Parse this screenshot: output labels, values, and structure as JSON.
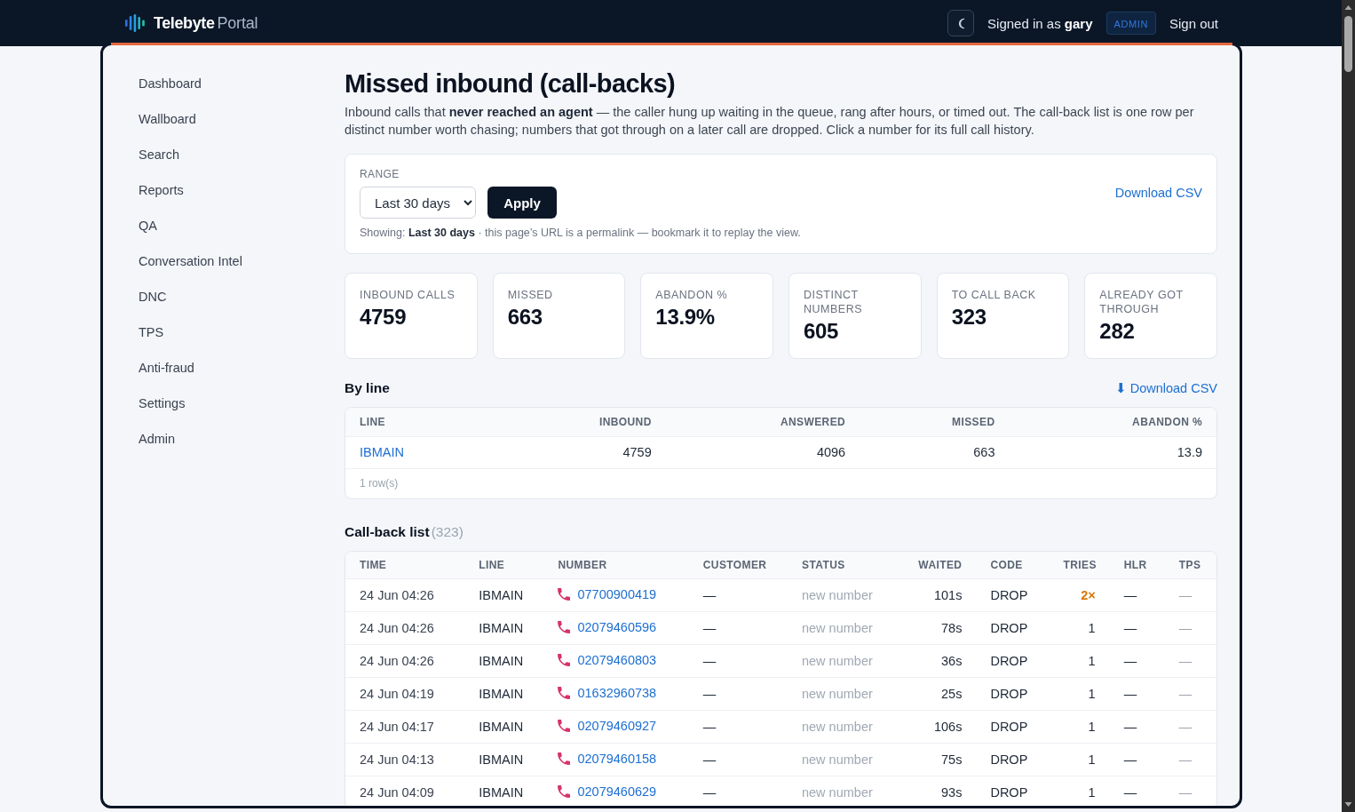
{
  "header": {
    "brand": "Telebyte",
    "brand_suffix": "Portal",
    "signed_in": "Signed in as **gary**",
    "role_badge": "ADMIN",
    "sign_out": "Sign out"
  },
  "sidebar": {
    "items": [
      {
        "label": "Dashboard",
        "selected": false
      },
      {
        "label": "Wallboard",
        "selected": false
      },
      {
        "label": "Search",
        "selected": false
      },
      {
        "label": "Reports",
        "selected": false
      },
      {
        "label": "QA",
        "selected": false
      },
      {
        "label": "Conversation Intel",
        "selected": false
      },
      {
        "label": "DNC",
        "selected": false
      },
      {
        "label": "TPS",
        "selected": false
      },
      {
        "label": "Anti-fraud",
        "selected": false
      },
      {
        "label": "Settings",
        "selected": false
      },
      {
        "label": "Admin",
        "selected": false
      }
    ]
  },
  "page": {
    "title": "Missed inbound (call-backs)",
    "description": "Inbound calls that **never reached an agent** — the caller hung up waiting in the queue, rang after hours, or timed out. The call-back list is one row per distinct number worth chasing; numbers that got through on a later call are dropped. Click a number for its full call history."
  },
  "range": {
    "label": "RANGE",
    "value": "Last 30 days",
    "apply": "Apply",
    "download": "Download CSV",
    "showing": "Showing: **Last 30 days** · this page’s URL is a permalink — bookmark it to replay the view."
  },
  "stats": [
    {
      "label": "INBOUND CALLS",
      "value": "4759"
    },
    {
      "label": "MISSED",
      "value": "663"
    },
    {
      "label": "ABANDON %",
      "value": "13.9%"
    },
    {
      "label": "DISTINCT NUMBERS",
      "value": "605"
    },
    {
      "label": "TO CALL BACK",
      "value": "323"
    },
    {
      "label": "ALREADY GOT THROUGH",
      "value": "282"
    }
  ],
  "by_line": {
    "title": "By line",
    "download": "⬇ Download CSV",
    "columns": [
      "LINE",
      "INBOUND",
      "ANSWERED",
      "MISSED",
      "ABANDON %"
    ],
    "rows": [
      {
        "line": "IBMAIN",
        "inbound": "4759",
        "answered": "4096",
        "missed": "663",
        "abandon": "13.9"
      }
    ],
    "footer": "1 row(s)"
  },
  "callbacks": {
    "title": "Call-back list",
    "count": "(323)",
    "columns": [
      "TIME",
      "LINE",
      "NUMBER",
      "CUSTOMER",
      "STATUS",
      "WAITED",
      "CODE",
      "TRIES",
      "HLR",
      "TPS"
    ],
    "rows": [
      {
        "time": "24 Jun 04:26",
        "line": "IBMAIN",
        "number": "07700900419",
        "customer": "—",
        "status": "new number",
        "waited": "101s",
        "code": "DROP",
        "tries": "2×",
        "repeat": true,
        "hlr": "—",
        "tps": "—"
      },
      {
        "time": "24 Jun 04:26",
        "line": "IBMAIN",
        "number": "02079460596",
        "customer": "—",
        "status": "new number",
        "waited": "78s",
        "code": "DROP",
        "tries": "1",
        "repeat": false,
        "hlr": "—",
        "tps": "—"
      },
      {
        "time": "24 Jun 04:26",
        "line": "IBMAIN",
        "number": "02079460803",
        "customer": "—",
        "status": "new number",
        "waited": "36s",
        "code": "DROP",
        "tries": "1",
        "repeat": false,
        "hlr": "—",
        "tps": "—"
      },
      {
        "time": "24 Jun 04:19",
        "line": "IBMAIN",
        "number": "01632960738",
        "customer": "—",
        "status": "new number",
        "waited": "25s",
        "code": "DROP",
        "tries": "1",
        "repeat": false,
        "hlr": "—",
        "tps": "—"
      },
      {
        "time": "24 Jun 04:17",
        "line": "IBMAIN",
        "number": "02079460927",
        "customer": "—",
        "status": "new number",
        "waited": "106s",
        "code": "DROP",
        "tries": "1",
        "repeat": false,
        "hlr": "—",
        "tps": "—"
      },
      {
        "time": "24 Jun 04:13",
        "line": "IBMAIN",
        "number": "02079460158",
        "customer": "—",
        "status": "new number",
        "waited": "75s",
        "code": "DROP",
        "tries": "1",
        "repeat": false,
        "hlr": "—",
        "tps": "—"
      },
      {
        "time": "24 Jun 04:09",
        "line": "IBMAIN",
        "number": "02079460629",
        "customer": "—",
        "status": "new number",
        "waited": "93s",
        "code": "DROP",
        "tries": "1",
        "repeat": false,
        "hlr": "—",
        "tps": "—"
      }
    ]
  }
}
